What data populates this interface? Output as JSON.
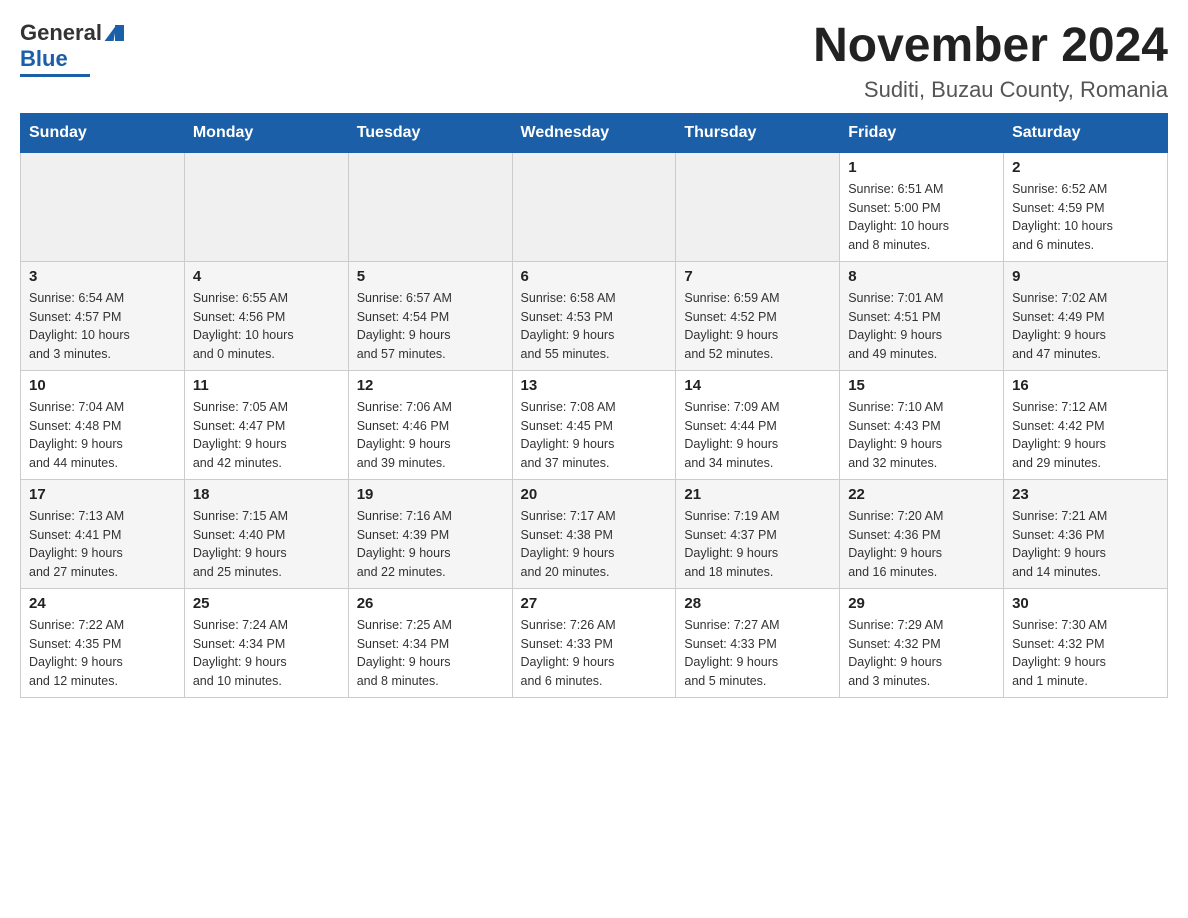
{
  "header": {
    "logo": {
      "general": "General",
      "blue": "Blue"
    },
    "title": "November 2024",
    "subtitle": "Suditi, Buzau County, Romania"
  },
  "weekdays": [
    "Sunday",
    "Monday",
    "Tuesday",
    "Wednesday",
    "Thursday",
    "Friday",
    "Saturday"
  ],
  "weeks": [
    [
      {
        "day": "",
        "info": ""
      },
      {
        "day": "",
        "info": ""
      },
      {
        "day": "",
        "info": ""
      },
      {
        "day": "",
        "info": ""
      },
      {
        "day": "",
        "info": ""
      },
      {
        "day": "1",
        "info": "Sunrise: 6:51 AM\nSunset: 5:00 PM\nDaylight: 10 hours\nand 8 minutes."
      },
      {
        "day": "2",
        "info": "Sunrise: 6:52 AM\nSunset: 4:59 PM\nDaylight: 10 hours\nand 6 minutes."
      }
    ],
    [
      {
        "day": "3",
        "info": "Sunrise: 6:54 AM\nSunset: 4:57 PM\nDaylight: 10 hours\nand 3 minutes."
      },
      {
        "day": "4",
        "info": "Sunrise: 6:55 AM\nSunset: 4:56 PM\nDaylight: 10 hours\nand 0 minutes."
      },
      {
        "day": "5",
        "info": "Sunrise: 6:57 AM\nSunset: 4:54 PM\nDaylight: 9 hours\nand 57 minutes."
      },
      {
        "day": "6",
        "info": "Sunrise: 6:58 AM\nSunset: 4:53 PM\nDaylight: 9 hours\nand 55 minutes."
      },
      {
        "day": "7",
        "info": "Sunrise: 6:59 AM\nSunset: 4:52 PM\nDaylight: 9 hours\nand 52 minutes."
      },
      {
        "day": "8",
        "info": "Sunrise: 7:01 AM\nSunset: 4:51 PM\nDaylight: 9 hours\nand 49 minutes."
      },
      {
        "day": "9",
        "info": "Sunrise: 7:02 AM\nSunset: 4:49 PM\nDaylight: 9 hours\nand 47 minutes."
      }
    ],
    [
      {
        "day": "10",
        "info": "Sunrise: 7:04 AM\nSunset: 4:48 PM\nDaylight: 9 hours\nand 44 minutes."
      },
      {
        "day": "11",
        "info": "Sunrise: 7:05 AM\nSunset: 4:47 PM\nDaylight: 9 hours\nand 42 minutes."
      },
      {
        "day": "12",
        "info": "Sunrise: 7:06 AM\nSunset: 4:46 PM\nDaylight: 9 hours\nand 39 minutes."
      },
      {
        "day": "13",
        "info": "Sunrise: 7:08 AM\nSunset: 4:45 PM\nDaylight: 9 hours\nand 37 minutes."
      },
      {
        "day": "14",
        "info": "Sunrise: 7:09 AM\nSunset: 4:44 PM\nDaylight: 9 hours\nand 34 minutes."
      },
      {
        "day": "15",
        "info": "Sunrise: 7:10 AM\nSunset: 4:43 PM\nDaylight: 9 hours\nand 32 minutes."
      },
      {
        "day": "16",
        "info": "Sunrise: 7:12 AM\nSunset: 4:42 PM\nDaylight: 9 hours\nand 29 minutes."
      }
    ],
    [
      {
        "day": "17",
        "info": "Sunrise: 7:13 AM\nSunset: 4:41 PM\nDaylight: 9 hours\nand 27 minutes."
      },
      {
        "day": "18",
        "info": "Sunrise: 7:15 AM\nSunset: 4:40 PM\nDaylight: 9 hours\nand 25 minutes."
      },
      {
        "day": "19",
        "info": "Sunrise: 7:16 AM\nSunset: 4:39 PM\nDaylight: 9 hours\nand 22 minutes."
      },
      {
        "day": "20",
        "info": "Sunrise: 7:17 AM\nSunset: 4:38 PM\nDaylight: 9 hours\nand 20 minutes."
      },
      {
        "day": "21",
        "info": "Sunrise: 7:19 AM\nSunset: 4:37 PM\nDaylight: 9 hours\nand 18 minutes."
      },
      {
        "day": "22",
        "info": "Sunrise: 7:20 AM\nSunset: 4:36 PM\nDaylight: 9 hours\nand 16 minutes."
      },
      {
        "day": "23",
        "info": "Sunrise: 7:21 AM\nSunset: 4:36 PM\nDaylight: 9 hours\nand 14 minutes."
      }
    ],
    [
      {
        "day": "24",
        "info": "Sunrise: 7:22 AM\nSunset: 4:35 PM\nDaylight: 9 hours\nand 12 minutes."
      },
      {
        "day": "25",
        "info": "Sunrise: 7:24 AM\nSunset: 4:34 PM\nDaylight: 9 hours\nand 10 minutes."
      },
      {
        "day": "26",
        "info": "Sunrise: 7:25 AM\nSunset: 4:34 PM\nDaylight: 9 hours\nand 8 minutes."
      },
      {
        "day": "27",
        "info": "Sunrise: 7:26 AM\nSunset: 4:33 PM\nDaylight: 9 hours\nand 6 minutes."
      },
      {
        "day": "28",
        "info": "Sunrise: 7:27 AM\nSunset: 4:33 PM\nDaylight: 9 hours\nand 5 minutes."
      },
      {
        "day": "29",
        "info": "Sunrise: 7:29 AM\nSunset: 4:32 PM\nDaylight: 9 hours\nand 3 minutes."
      },
      {
        "day": "30",
        "info": "Sunrise: 7:30 AM\nSunset: 4:32 PM\nDaylight: 9 hours\nand 1 minute."
      }
    ]
  ]
}
